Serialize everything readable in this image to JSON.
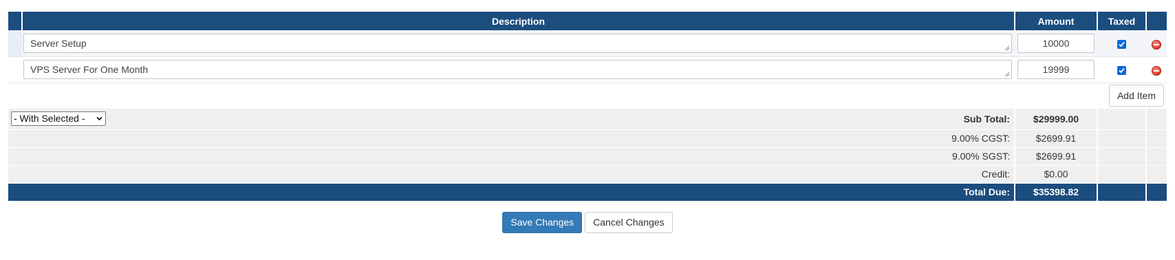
{
  "table": {
    "headers": {
      "description": "Description",
      "amount": "Amount",
      "taxed": "Taxed"
    },
    "items": [
      {
        "description": "Server Setup",
        "amount": "10000",
        "taxed": true
      },
      {
        "description": "VPS Server For One Month",
        "amount": "19999",
        "taxed": true
      }
    ],
    "add_item_label": "Add Item",
    "with_selected": "- With Selected -",
    "totals": [
      {
        "label": "Sub Total:",
        "value": "$29999.00"
      },
      {
        "label": "9.00% CGST:",
        "value": "$2699.91"
      },
      {
        "label": "9.00% SGST:",
        "value": "$2699.91"
      },
      {
        "label": "Credit:",
        "value": "$0.00"
      }
    ],
    "total_due": {
      "label": "Total Due:",
      "value": "$35398.82"
    }
  },
  "actions": {
    "save": "Save Changes",
    "cancel": "Cancel Changes"
  },
  "colors": {
    "header": "#1b4d7e",
    "primary_button": "#337ab7",
    "checkbox": "#0b6bd6",
    "remove": "#d9352b"
  },
  "icons": {
    "remove": "minus-circle-icon",
    "checkbox": "checkmark-icon",
    "dropdown": "chevron-down-icon",
    "resize": "resize-grip-icon"
  }
}
